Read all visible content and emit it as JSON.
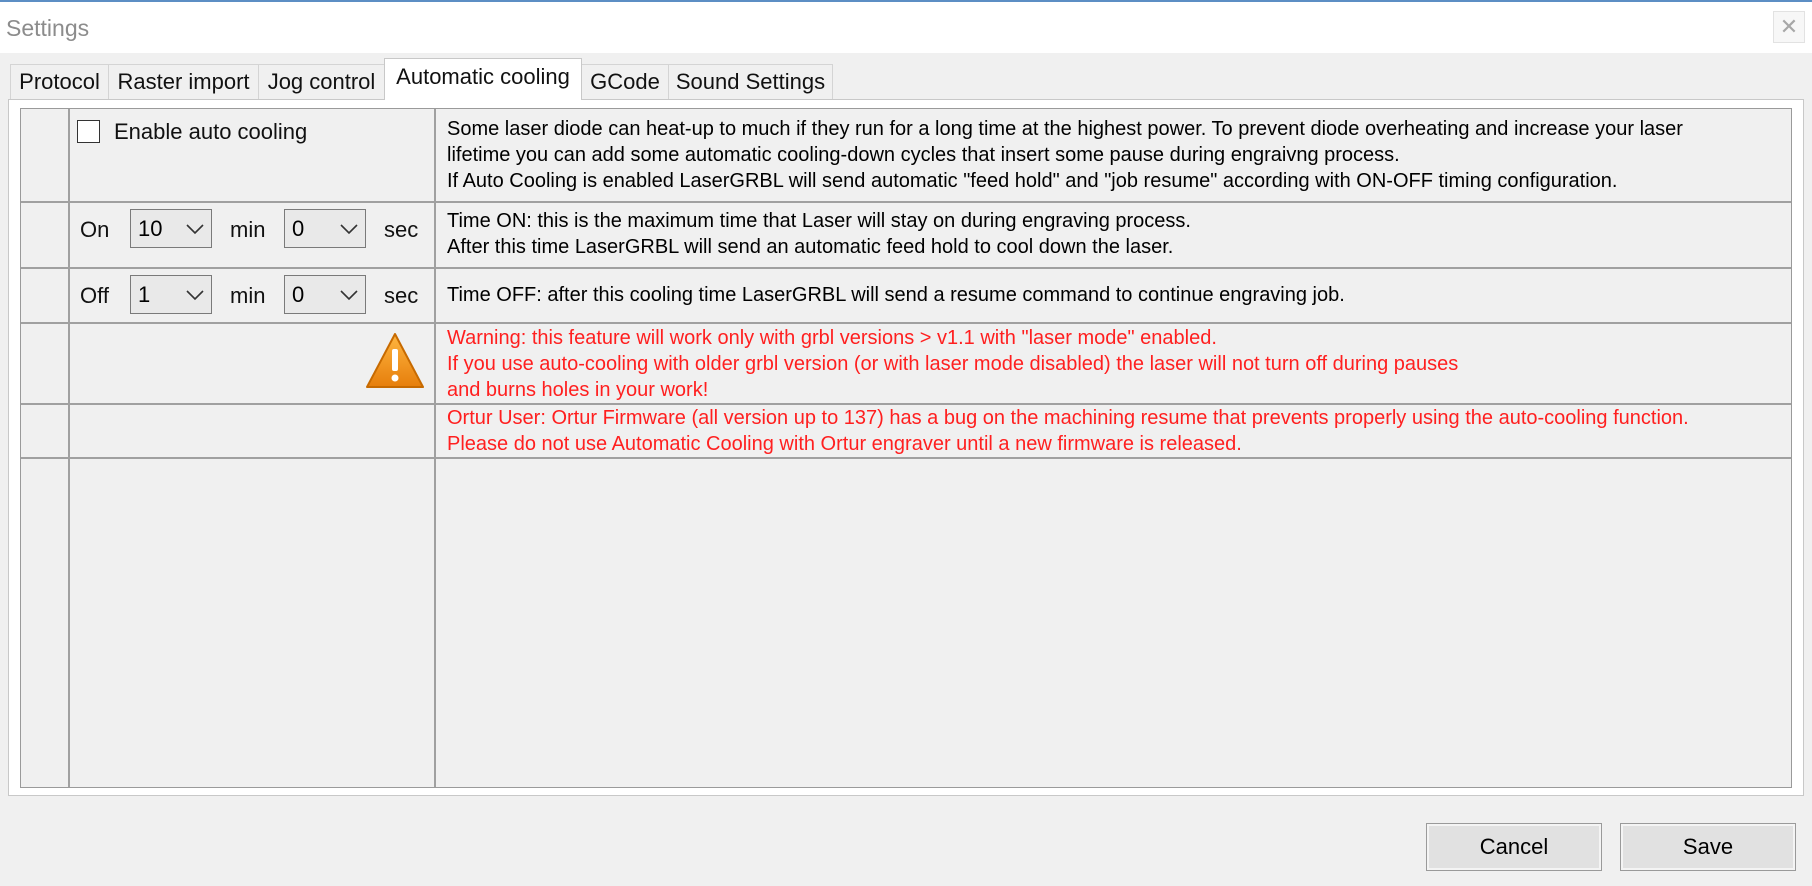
{
  "window": {
    "title": "Settings",
    "close_glyph": "✕"
  },
  "tabs": [
    {
      "label": "Protocol"
    },
    {
      "label": "Raster import"
    },
    {
      "label": "Jog control"
    },
    {
      "label": "Automatic cooling",
      "active": true
    },
    {
      "label": "GCode"
    },
    {
      "label": "Sound Settings"
    }
  ],
  "auto_cooling": {
    "enable_label": "Enable auto cooling",
    "enabled": false,
    "description": [
      "Some laser diode can heat-up to much if they run for a long time at the highest power. To prevent diode overheating and increase your laser",
      "lifetime you can add some automatic cooling-down cycles that insert some pause during engraivng process.",
      "If Auto Cooling is enabled LaserGRBL will send automatic \"feed hold\" and \"job resume\" according with ON-OFF timing configuration."
    ],
    "on_row": {
      "label": "On",
      "minutes": "10",
      "min_unit": "min",
      "seconds": "0",
      "sec_unit": "sec",
      "description": [
        "Time ON: this is the maximum time that Laser will stay on during engraving process.",
        "After this time LaserGRBL will send an automatic feed hold to cool down the laser."
      ]
    },
    "off_row": {
      "label": "Off",
      "minutes": "1",
      "min_unit": "min",
      "seconds": "0",
      "sec_unit": "sec",
      "description": [
        "Time OFF: after this cooling time LaserGRBL will send a resume command to continue engraving job."
      ]
    },
    "warning": {
      "icon": "warning-icon",
      "lines": [
        "Warning: this feature will work only with grbl versions > v1.1 with \"laser mode\" enabled.",
        "If you use auto-cooling with older grbl version (or with laser mode disabled) the laser will not turn off during pauses",
        "and burns holes in your work!"
      ]
    },
    "ortur_note": {
      "lines": [
        "Ortur User: Ortur Firmware (all version up to 137) has a bug on the machining resume that prevents properly using the auto-cooling function.",
        "Please do not use Automatic Cooling with Ortur engraver until a new firmware is released."
      ]
    }
  },
  "buttons": {
    "cancel": "Cancel",
    "save": "Save"
  },
  "colors": {
    "warning_text": "#ff1f1f",
    "warning_icon": "#f0901a",
    "title_bar_accent": "#5c8ec4"
  }
}
